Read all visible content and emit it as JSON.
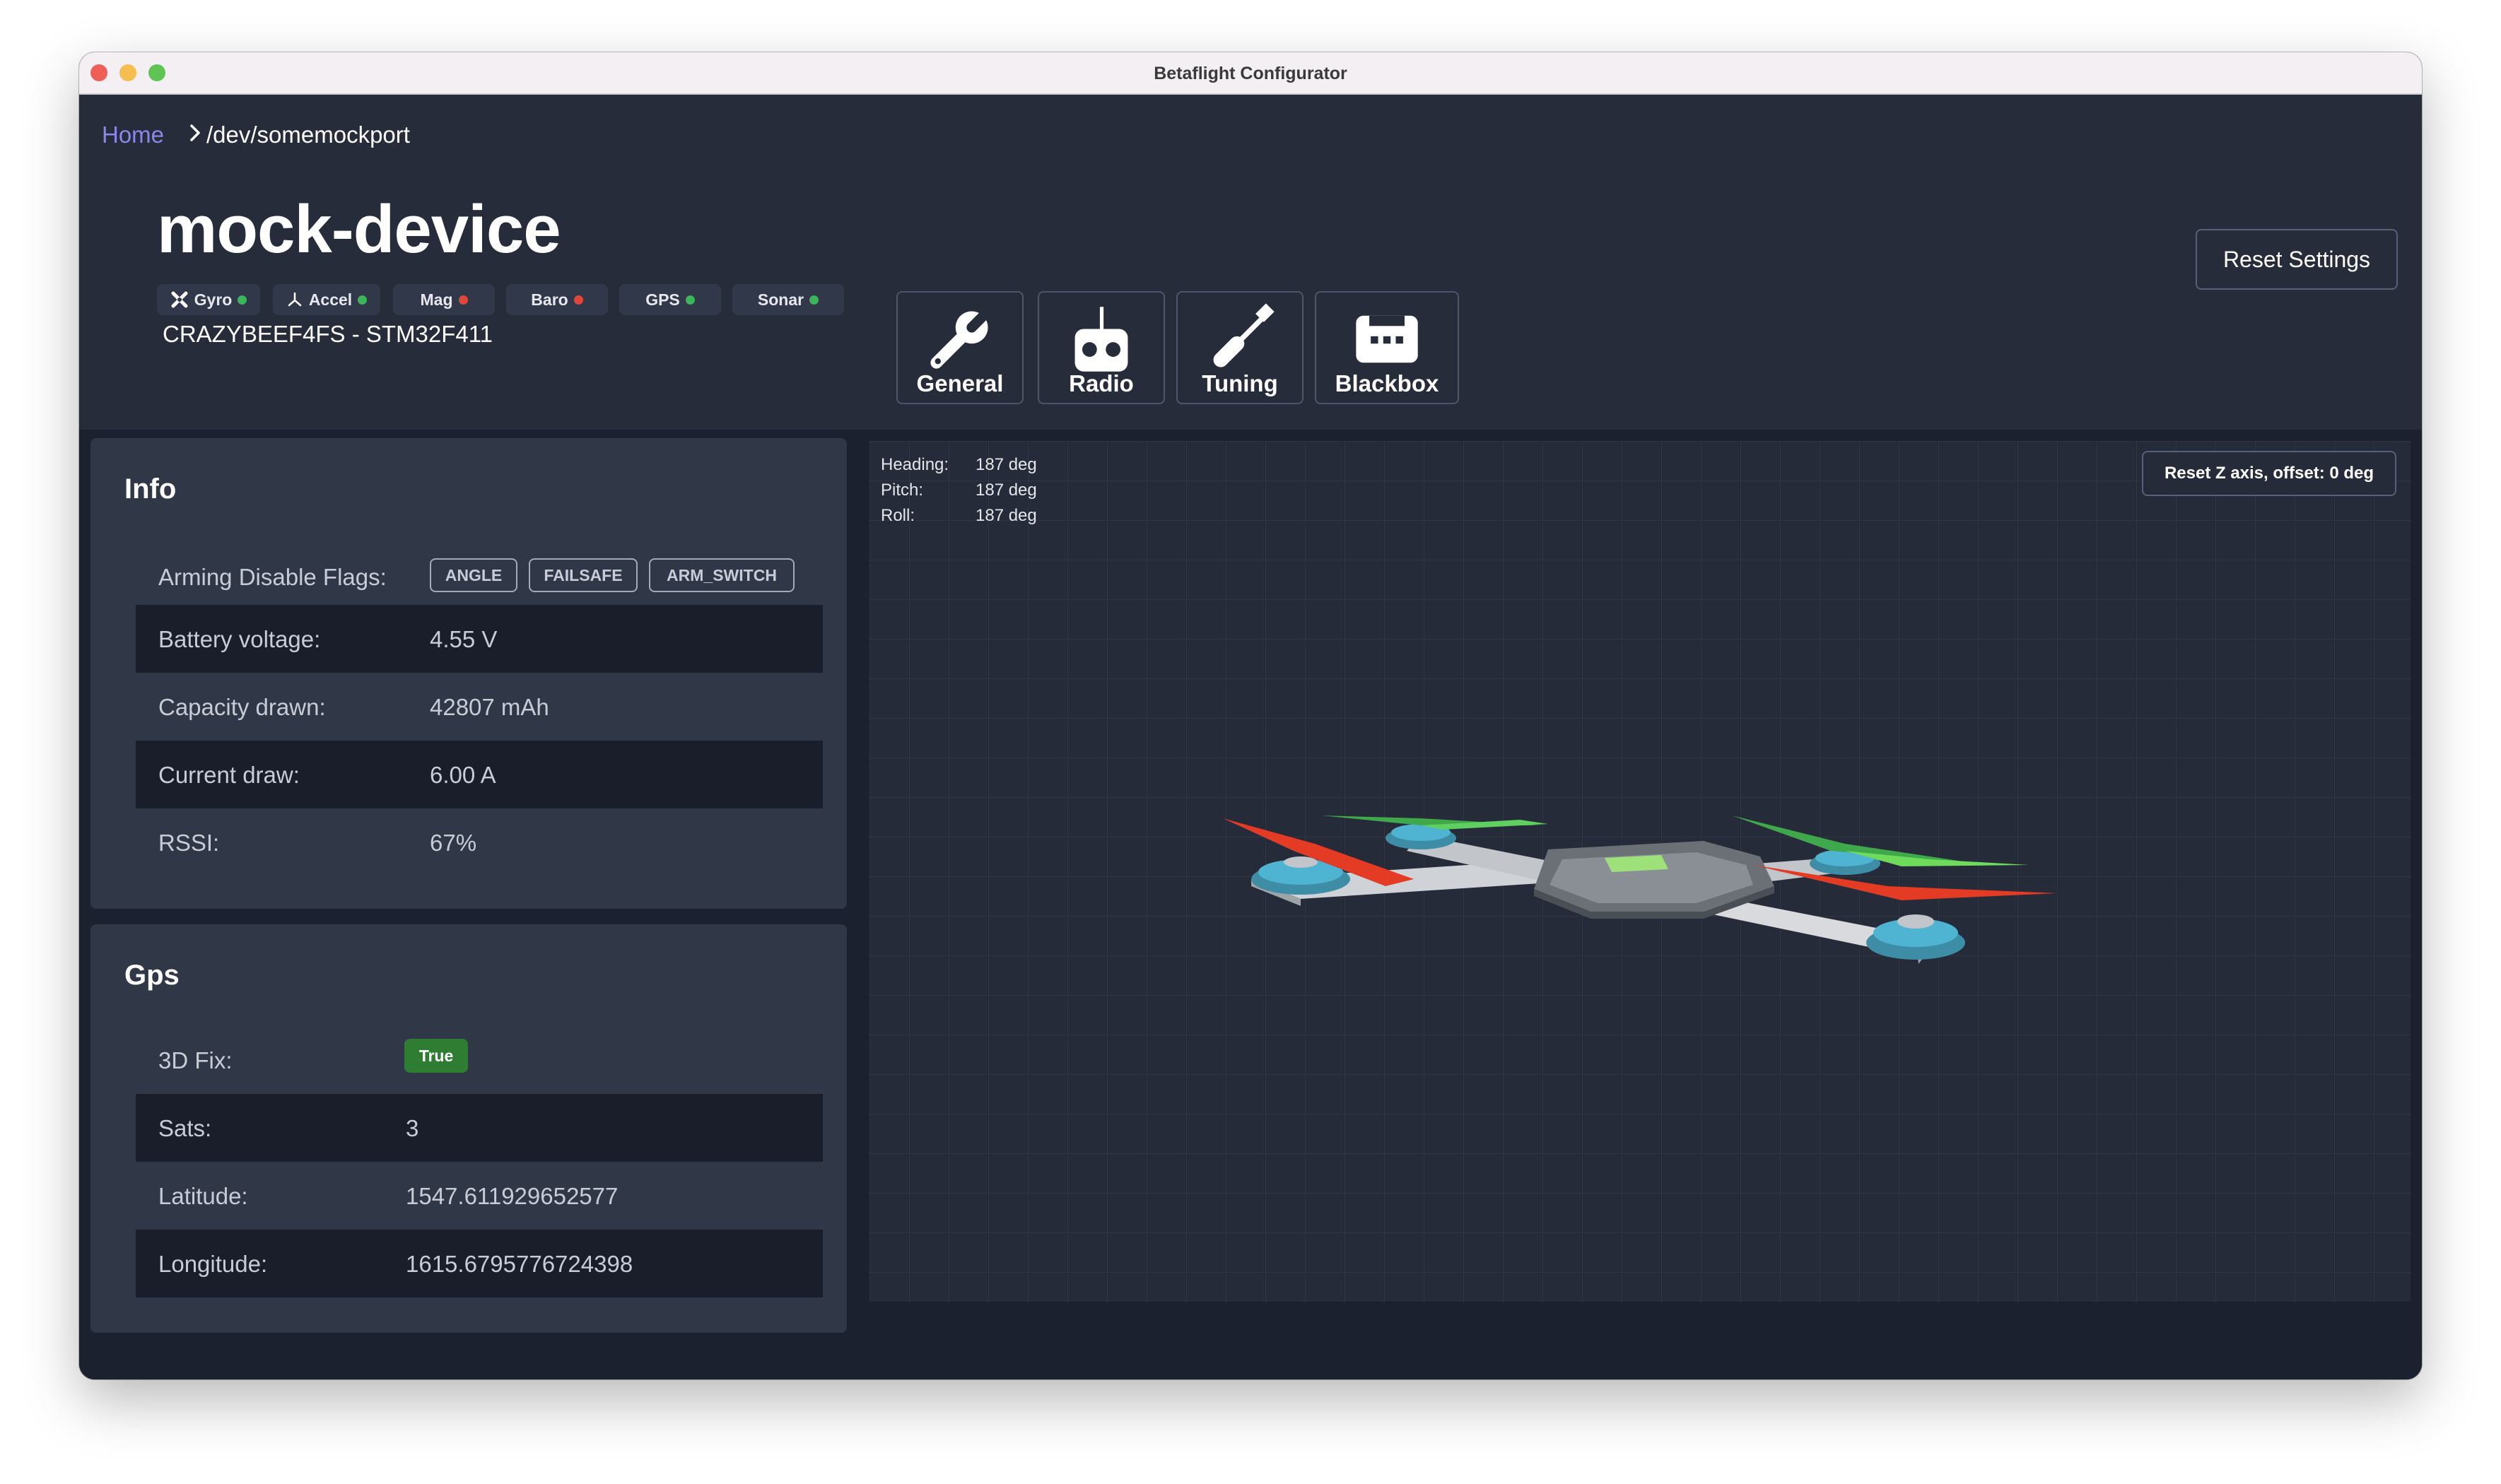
{
  "window": {
    "title": "Betaflight Configurator"
  },
  "breadcrumb": {
    "home": "Home",
    "port": "/dev/somemockport"
  },
  "device": {
    "name": "mock-device",
    "board": "CRAZYBEEF4FS - STM32F411",
    "sensors": [
      {
        "label": "Gyro",
        "status": "ok",
        "icon": "gyro-icon"
      },
      {
        "label": "Accel",
        "status": "ok",
        "icon": "accel-icon"
      },
      {
        "label": "Mag",
        "status": "error"
      },
      {
        "label": "Baro",
        "status": "error"
      },
      {
        "label": "GPS",
        "status": "ok"
      },
      {
        "label": "Sonar",
        "status": "ok"
      }
    ]
  },
  "nav": [
    {
      "label": "General",
      "icon": "wrench-icon"
    },
    {
      "label": "Radio",
      "icon": "radio-icon"
    },
    {
      "label": "Tuning",
      "icon": "screwdriver-icon"
    },
    {
      "label": "Blackbox",
      "icon": "blackbox-icon"
    }
  ],
  "actions": {
    "reset_settings": "Reset Settings"
  },
  "info": {
    "title": "Info",
    "arming_label": "Arming Disable Flags:",
    "flags": [
      "ANGLE",
      "FAILSAFE",
      "ARM_SWITCH"
    ],
    "rows": [
      {
        "label": "Battery voltage:",
        "value": "4.55 V"
      },
      {
        "label": "Capacity drawn:",
        "value": "42807 mAh"
      },
      {
        "label": "Current draw:",
        "value": "6.00 A"
      },
      {
        "label": "RSSI:",
        "value": "67%"
      }
    ]
  },
  "gps": {
    "title": "Gps",
    "fix_label": "3D Fix:",
    "fix_value": "True",
    "rows": [
      {
        "label": "Sats:",
        "value": "3"
      },
      {
        "label": "Latitude:",
        "value": "1547.611929652577"
      },
      {
        "label": "Longitude:",
        "value": "1615.6795776724398"
      }
    ]
  },
  "attitude": {
    "heading_label": "Heading:",
    "heading": "187 deg",
    "pitch_label": "Pitch:",
    "pitch": "187 deg",
    "roll_label": "Roll:",
    "roll": "187 deg",
    "reset_z": "Reset Z axis, offset: 0 deg"
  },
  "colors": {
    "accent": "#8a87ea",
    "status_ok": "#3cb55a",
    "status_error": "#e0473b",
    "fix_true": "#2e7d32"
  }
}
